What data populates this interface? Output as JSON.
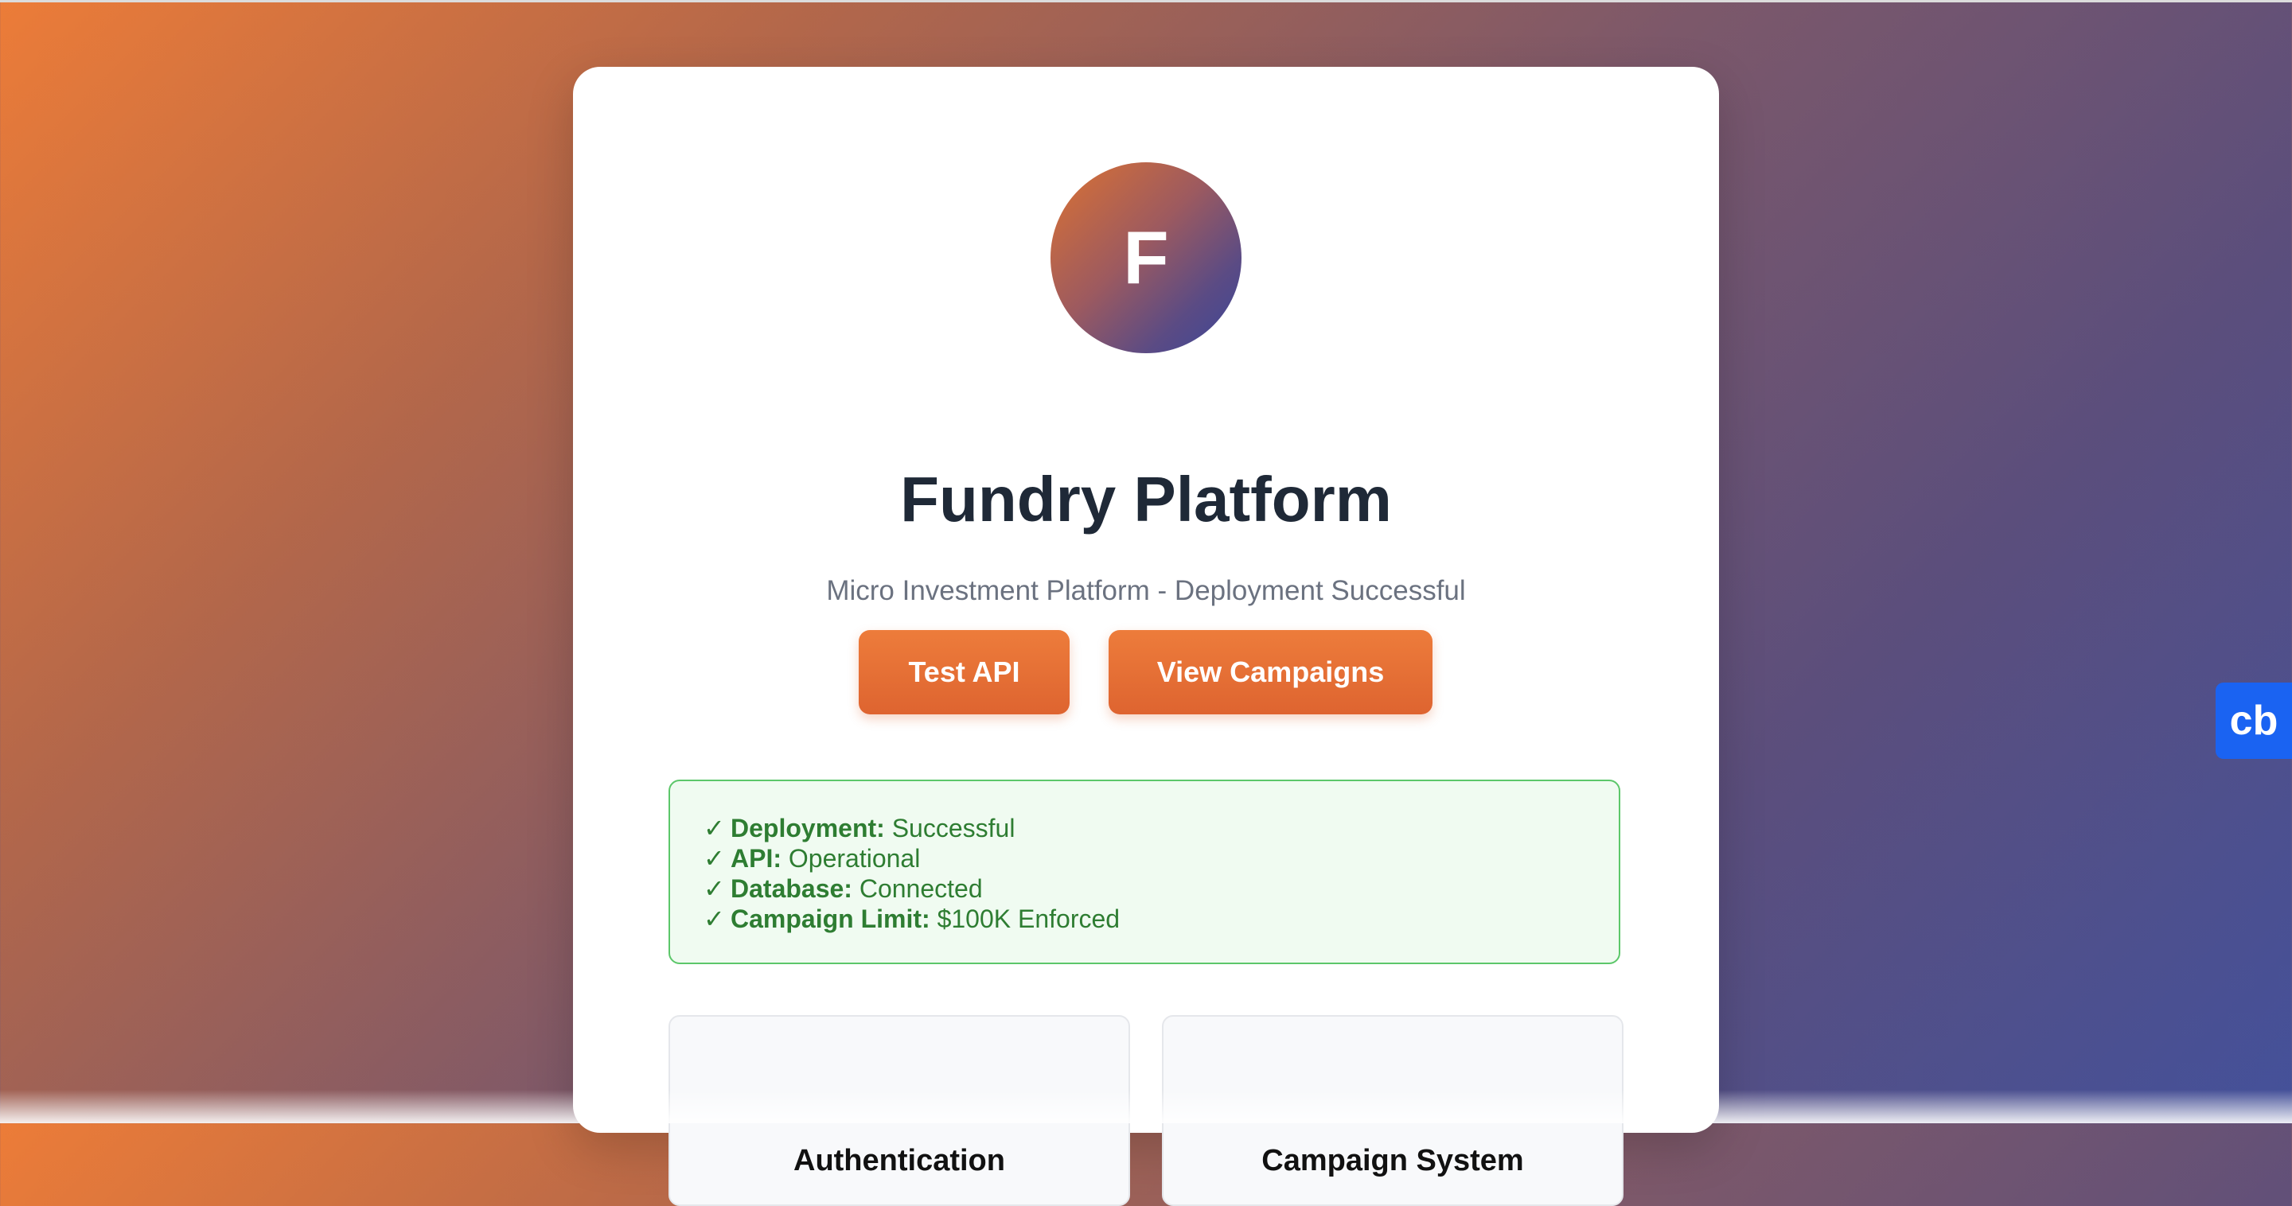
{
  "brand": {
    "logo_letter": "F",
    "title": "Fundry Platform",
    "subtitle": "Micro Investment Platform - Deployment Successful"
  },
  "actions": {
    "test_api_label": "Test API",
    "view_campaigns_label": "View Campaigns"
  },
  "status": {
    "check_glyph": "✓",
    "items": [
      {
        "label": "Deployment:",
        "value": "Successful"
      },
      {
        "label": "API:",
        "value": "Operational"
      },
      {
        "label": "Database:",
        "value": "Connected"
      },
      {
        "label": "Campaign Limit:",
        "value": "$100K Enforced"
      }
    ]
  },
  "features": [
    {
      "title": "Authentication"
    },
    {
      "title": "Campaign System"
    }
  ],
  "widget": {
    "label": "cb"
  },
  "colors": {
    "accent": "#e96f34",
    "success_text": "#2e7d32",
    "success_border": "#5cc76a",
    "widget_blue": "#1a63f2"
  }
}
